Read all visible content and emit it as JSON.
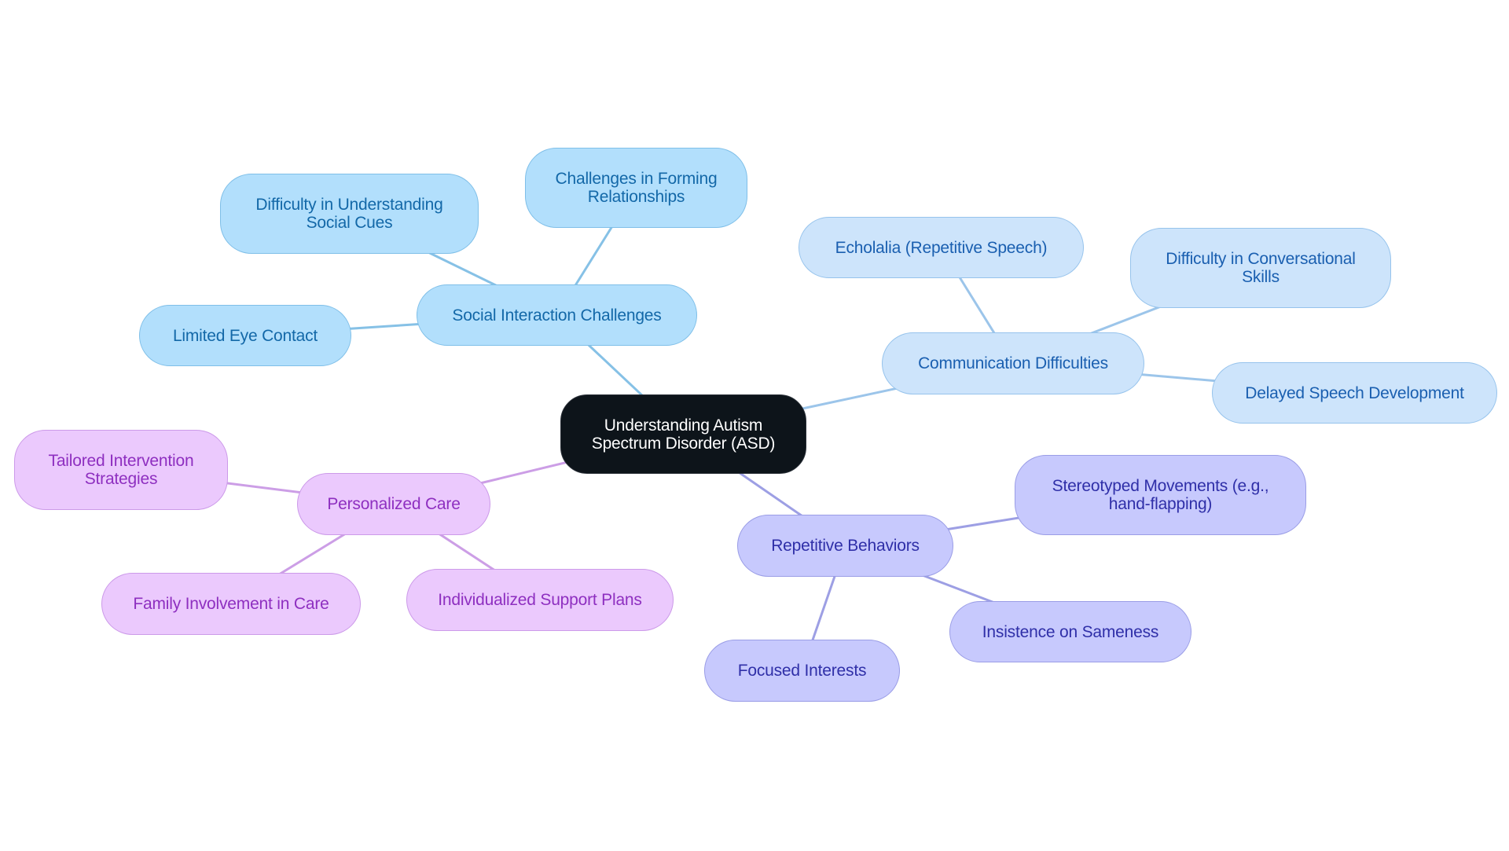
{
  "diagram": {
    "type": "mind-map",
    "root": {
      "id": "root",
      "label": "Understanding Autism\nSpectrum Disorder (ASD)"
    },
    "colors": {
      "root_fill": "#0d141a",
      "root_text": "#ffffff",
      "social_fill": "#b2dffc",
      "social_edge": "#86c1e6",
      "social_text": "#1368a8",
      "communication_fill": "#cde4fb",
      "communication_edge": "#9cc5ea",
      "communication_text": "#1a5fb0",
      "repetitive_fill": "#c7c9fd",
      "repetitive_edge": "#9d9fe4",
      "repetitive_text": "#2f2fa8",
      "care_fill": "#ebc9fd",
      "care_edge": "#cc9ee6",
      "care_text": "#8e2fc0"
    },
    "branches": [
      {
        "id": "social",
        "label": "Social Interaction Challenges",
        "theme": "blue",
        "children": [
          {
            "id": "social-cues",
            "label": "Difficulty in Understanding\nSocial Cues"
          },
          {
            "id": "relationships",
            "label": "Challenges in Forming\nRelationships"
          },
          {
            "id": "eye-contact",
            "label": "Limited Eye Contact"
          }
        ]
      },
      {
        "id": "communication",
        "label": "Communication Difficulties",
        "theme": "lightblue",
        "children": [
          {
            "id": "echolalia",
            "label": "Echolalia (Repetitive Speech)"
          },
          {
            "id": "conversational",
            "label": "Difficulty in Conversational\nSkills"
          },
          {
            "id": "delayed-speech",
            "label": "Delayed Speech Development"
          }
        ]
      },
      {
        "id": "repetitive",
        "label": "Repetitive Behaviors",
        "theme": "indigo",
        "children": [
          {
            "id": "stereotyped",
            "label": "Stereotyped Movements (e.g.,\nhand-flapping)"
          },
          {
            "id": "sameness",
            "label": "Insistence on Sameness"
          },
          {
            "id": "focused",
            "label": "Focused Interests"
          }
        ]
      },
      {
        "id": "care",
        "label": "Personalized Care",
        "theme": "purple",
        "children": [
          {
            "id": "tailored",
            "label": "Tailored Intervention\nStrategies"
          },
          {
            "id": "family",
            "label": "Family Involvement in Care"
          },
          {
            "id": "support-plans",
            "label": "Individualized Support Plans"
          }
        ]
      }
    ]
  }
}
